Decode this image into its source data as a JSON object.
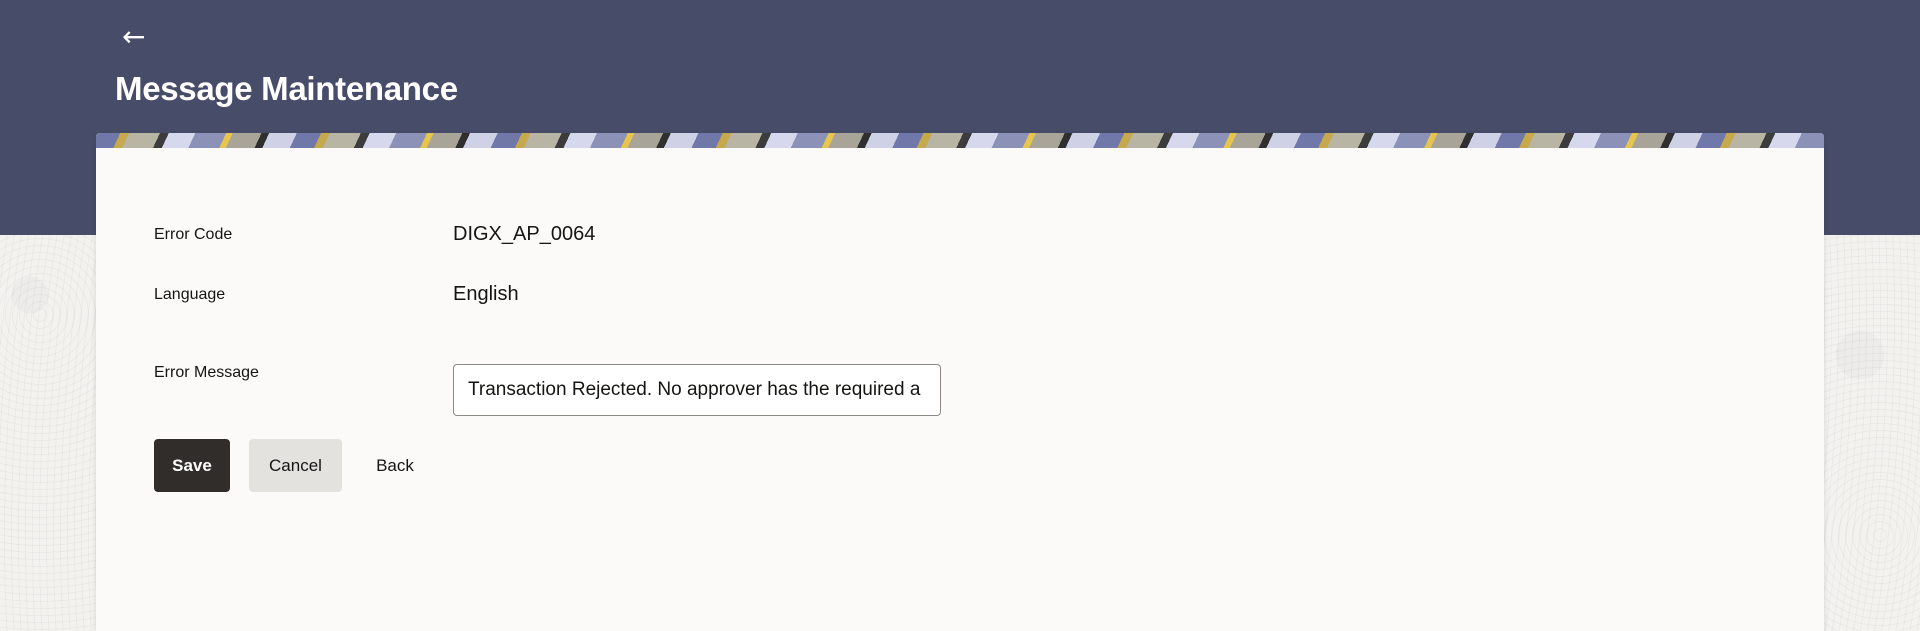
{
  "header": {
    "title": "Message Maintenance",
    "back_icon": "back-arrow-icon",
    "background_color": "#474c69"
  },
  "form": {
    "error_code_label": "Error Code",
    "error_code_value": "DIGX_AP_0064",
    "language_label": "Language",
    "language_value": "English",
    "error_message_label": "Error Message",
    "error_message_value": "Transaction Rejected. No approver has the required a"
  },
  "actions": {
    "save_label": "Save",
    "cancel_label": "Cancel",
    "back_label": "Back",
    "primary_color": "#312d2a"
  }
}
